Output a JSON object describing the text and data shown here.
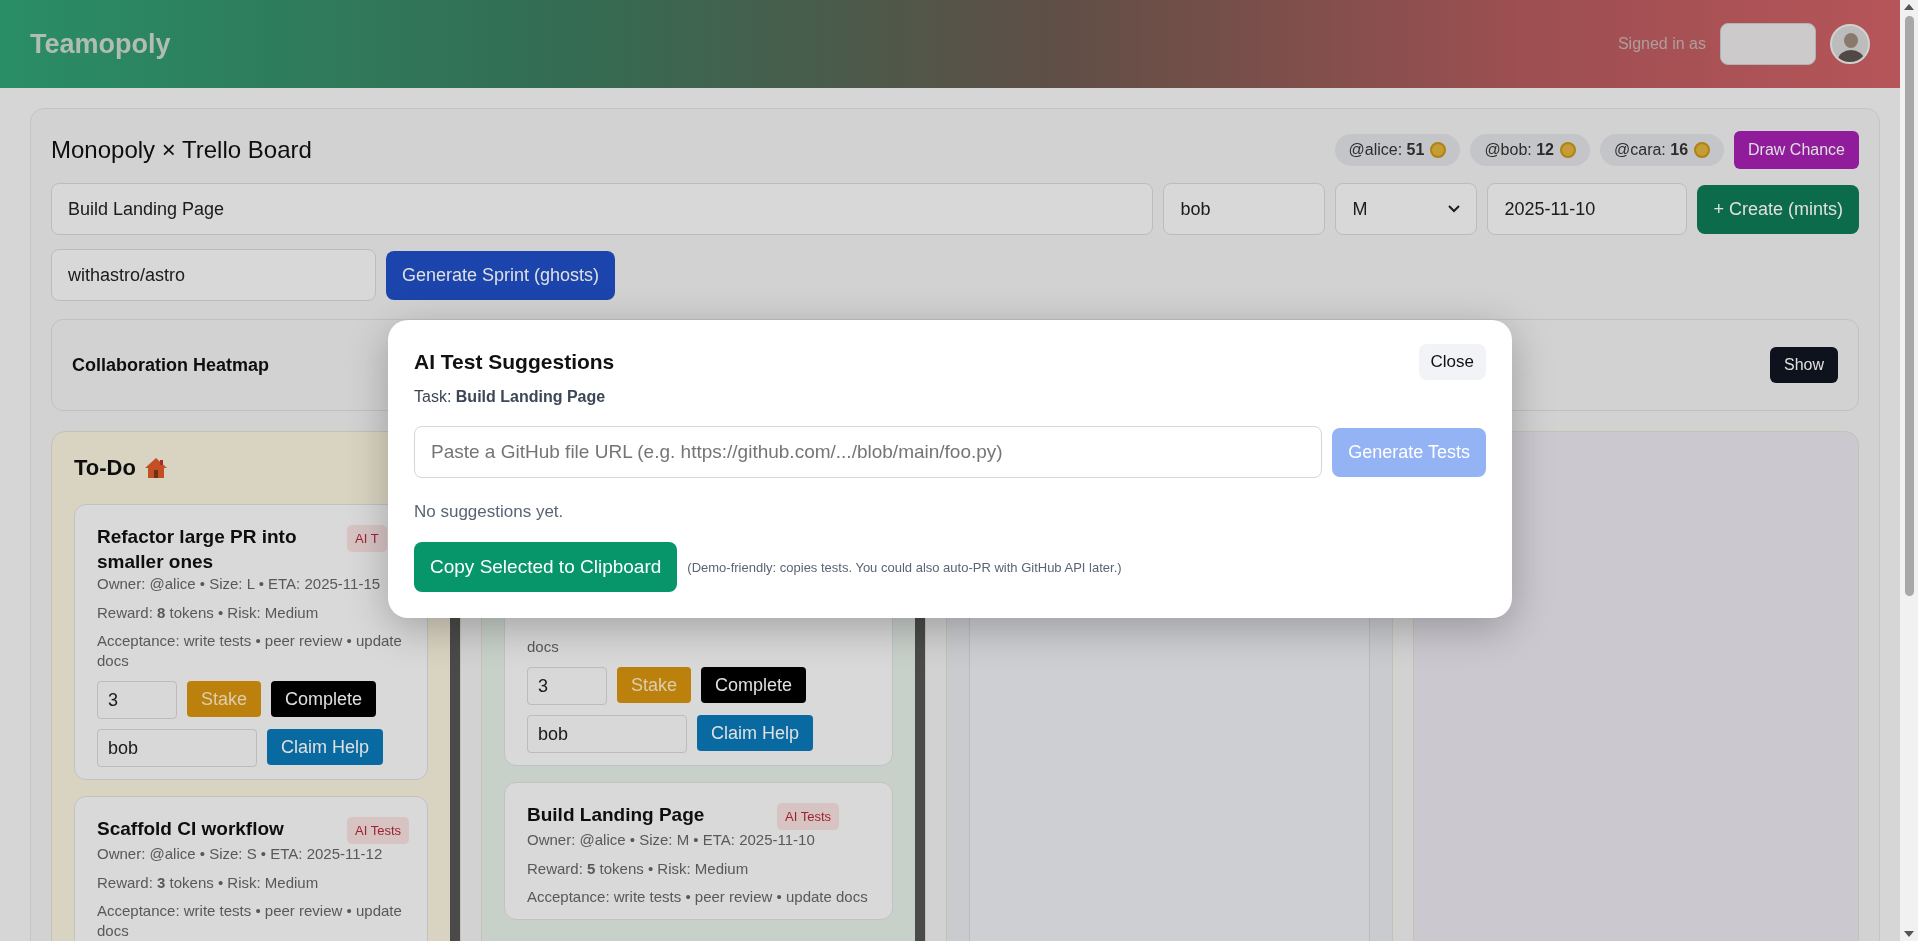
{
  "header": {
    "brand": "Teamopoly",
    "signed_in_label": "Signed in as"
  },
  "board": {
    "title": "Monopoly × Trello Board",
    "balances": [
      {
        "user": "@alice:",
        "amount": "51"
      },
      {
        "user": "@bob:",
        "amount": "12"
      },
      {
        "user": "@cara:",
        "amount": "16"
      }
    ],
    "draw_chance_button": "Draw Chance",
    "form": {
      "title_value": "Build Landing Page",
      "owner_value": "bob",
      "size_value": "M",
      "date_value": "2025-11-10",
      "create_button": "+ Create (mints)"
    },
    "repo_value": "withastro/astro",
    "sprint_button": "Generate Sprint (ghosts)"
  },
  "heatmap": {
    "title": "Collaboration Heatmap",
    "button": "Show"
  },
  "columns": [
    {
      "title": "To-Do",
      "cards": [
        {
          "title": "Refactor large PR into smaller ones",
          "badge": "AI T",
          "meta": "Owner: @alice • Size: L • ETA: 2025-11-15",
          "reward": "Reward: **8** tokens • Risk: Medium",
          "acceptance": "Acceptance: write tests • peer review • update docs",
          "stake_value": "3",
          "stake_button": "Stake",
          "complete_button": "Complete",
          "helper_value": "bob",
          "claim_button": "Claim Help"
        },
        {
          "title": "Scaffold CI workflow",
          "badge": "AI Tests",
          "meta": "Owner: @alice • Size: S • ETA: 2025-11-12",
          "reward": "Reward: **3** tokens • Risk: Medium",
          "acceptance": "Acceptance: write tests • peer review • update docs"
        }
      ]
    },
    {
      "cards": [
        {
          "acceptance": "docs",
          "stake_value": "3",
          "stake_button": "Stake",
          "complete_button": "Complete",
          "helper_value": "bob",
          "claim_button": "Claim Help"
        },
        {
          "title": "Build Landing Page",
          "badge": "AI Tests",
          "meta": "Owner: @alice • Size: M • ETA: 2025-11-10",
          "reward": "Reward: **5** tokens • Risk: Medium",
          "acceptance": "Acceptance: write tests • peer review • update docs"
        }
      ]
    },
    {},
    {}
  ],
  "modal": {
    "title": "AI Test Suggestions",
    "close_button": "Close",
    "task": "Task: **Build Landing Page**",
    "url_placeholder": "Paste a GitHub file URL (e.g. https://github.com/.../blob/main/foo.py)",
    "generate_button": "Generate Tests",
    "generate_disabled": true,
    "empty_text": "No suggestions yet.",
    "copy_button": "Copy Selected to Clipboard",
    "note": "(Demo-friendly: copies tests. You could also auto-PR with GitHub API later.)"
  }
}
